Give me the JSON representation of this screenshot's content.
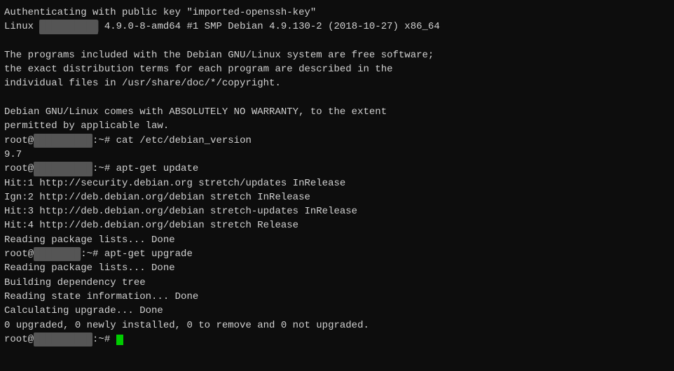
{
  "terminal": {
    "lines": [
      {
        "id": "line1",
        "text": "Authenticating with public key \"imported-openssh-key\""
      },
      {
        "id": "line2",
        "text": "Linux [REDACTED] 4.9.0-8-amd64 #1 SMP Debian 4.9.130-2 (2018-10-27) x86_64",
        "has_redacted": true
      },
      {
        "id": "line3",
        "text": ""
      },
      {
        "id": "line4",
        "text": "The programs included with the Debian GNU/Linux system are free software;"
      },
      {
        "id": "line5",
        "text": "the exact distribution terms for each program are described in the"
      },
      {
        "id": "line6",
        "text": "individual files in /usr/share/doc/*/copyright."
      },
      {
        "id": "line7",
        "text": ""
      },
      {
        "id": "line8",
        "text": "Debian GNU/Linux comes with ABSOLUTELY NO WARRANTY, to the extent"
      },
      {
        "id": "line9",
        "text": "permitted by applicable law."
      },
      {
        "id": "line10",
        "text": "root@[REDACTED]:~# cat /etc/debian_version",
        "is_prompt": true,
        "command": "cat /etc/debian_version"
      },
      {
        "id": "line11",
        "text": "9.7"
      },
      {
        "id": "line12",
        "text": "root@[REDACTED]:~# apt-get update",
        "is_prompt": true,
        "command": "apt-get update"
      },
      {
        "id": "line13",
        "text": "Hit:1 http://security.debian.org stretch/updates InRelease"
      },
      {
        "id": "line14",
        "text": "Ign:2 http://deb.debian.org/debian stretch InRelease"
      },
      {
        "id": "line15",
        "text": "Hit:3 http://deb.debian.org/debian stretch-updates InRelease"
      },
      {
        "id": "line16",
        "text": "Hit:4 http://deb.debian.org/debian stretch Release"
      },
      {
        "id": "line17",
        "text": "Reading package lists... Done"
      },
      {
        "id": "line18",
        "text": "root@[REDACTED]:~# apt-get upgrade",
        "is_prompt": true,
        "command": "apt-get upgrade"
      },
      {
        "id": "line19",
        "text": "Reading package lists... Done"
      },
      {
        "id": "line20",
        "text": "Building dependency tree"
      },
      {
        "id": "line21",
        "text": "Reading state information... Done"
      },
      {
        "id": "line22",
        "text": "Calculating upgrade... Done"
      },
      {
        "id": "line23",
        "text": "0 upgraded, 0 newly installed, 0 to remove and 0 not upgraded."
      },
      {
        "id": "line24",
        "text": "root@[REDACTED]:~# ",
        "is_prompt": true,
        "is_last": true
      }
    ],
    "redacted_label": "██████████",
    "prompt_prefix": "root@",
    "prompt_suffix": ":~# "
  }
}
